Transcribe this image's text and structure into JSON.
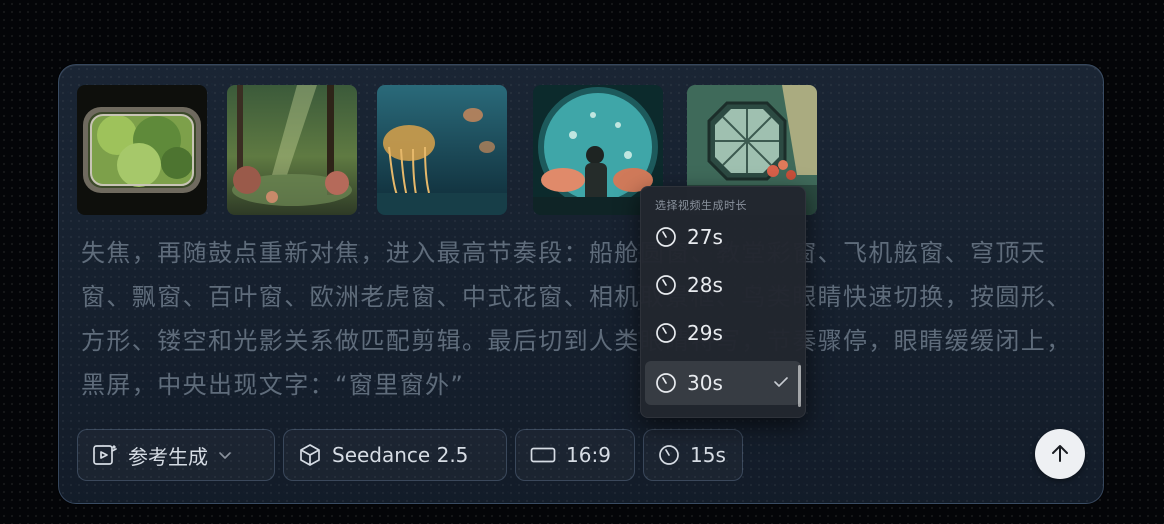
{
  "reference_images": [
    {
      "alt": "round window with green foliage"
    },
    {
      "alt": "forest pond with sunlight"
    },
    {
      "alt": "jellyfish aquarium"
    },
    {
      "alt": "person at round aquarium window"
    },
    {
      "alt": "octagonal window with flowers"
    }
  ],
  "prompt": {
    "text": "失焦，再随鼓点重新对焦，进入最高节奏段：船舱圆窗、教堂彩窗、飞机舷窗、穹顶天窗、飘窗、百叶窗、欧洲老虎窗、中式花窗、相机取景框、鸟类眼睛快速切换，按圆形、方形、镂空和光影关系做匹配剪辑。最后切到人类眼睛特写，节奏骤停，眼睛缓缓闭上，黑屏，中央出现文字：“窗里窗外”"
  },
  "toolbar": {
    "mode_label": "参考生成",
    "model_label": "Seedance 2.5",
    "ratio_label": "16:9",
    "duration_label": "15s"
  },
  "duration_dropdown": {
    "title": "选择视频生成时长",
    "options": [
      "27s",
      "28s",
      "29s",
      "30s"
    ],
    "selected": "30s"
  },
  "icons": {
    "mode": "reference-video-icon",
    "model": "cube-icon",
    "ratio": "aspect-ratio-icon",
    "duration": "clock-icon",
    "send": "arrow-up-icon",
    "check": "check-icon",
    "caret": "chevron-down-icon"
  },
  "colors": {
    "panel_bg": "#1a2636",
    "text_dim": "#5f6c7b",
    "text_bright": "#d6dce4",
    "dropdown_bg": "#22262e",
    "send_bg": "#eef0f3"
  }
}
